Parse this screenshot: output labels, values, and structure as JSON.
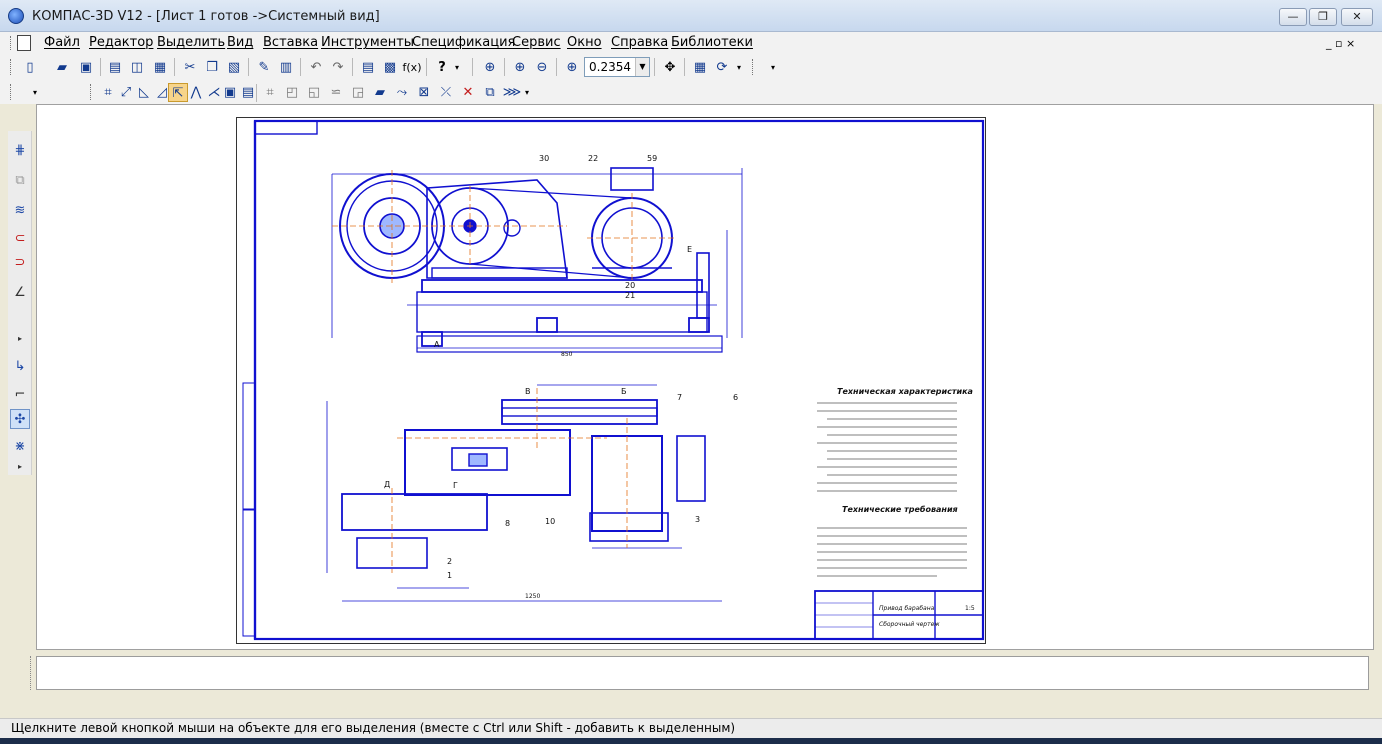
{
  "window": {
    "title": "КОМПАС-3D V12 - [Лист 1 готов ->Системный вид]",
    "controls": {
      "minimize": "—",
      "restore": "❐",
      "close": "✕"
    }
  },
  "menu": {
    "items": [
      "Файл",
      "Редактор",
      "Выделить",
      "Вид",
      "Вставка",
      "Инструменты",
      "Спецификация",
      "Сервис",
      "Окно",
      "Справка",
      "Библиотеки"
    ],
    "mdi_controls": "_ ▫ ×"
  },
  "toolbar": {
    "zoom_value": "0.2354",
    "fx_label": "f(x)",
    "help_label": "?"
  },
  "drawing": {
    "leaders_top": [
      "30",
      "22",
      "59",
      "20",
      "21",
      "Е",
      "А"
    ],
    "leaders_bottom": [
      "7",
      "6",
      "В",
      "Б",
      "Д",
      "Г",
      "8",
      "10",
      "3",
      "2",
      "1"
    ],
    "dim_top_total": "850",
    "dim_bottom_width": "1250",
    "tech_char_title": "Техническая характеристика",
    "tech_req_title": "Технические требования",
    "title_block": {
      "name": "Привод барабана",
      "doc_type": "Сборочный чертеж",
      "scale": "1:5"
    }
  },
  "status": {
    "hint": "Щелкните левой кнопкой мыши на объекте для его выделения (вместе с Ctrl или Shift - добавить к выделенным)"
  }
}
